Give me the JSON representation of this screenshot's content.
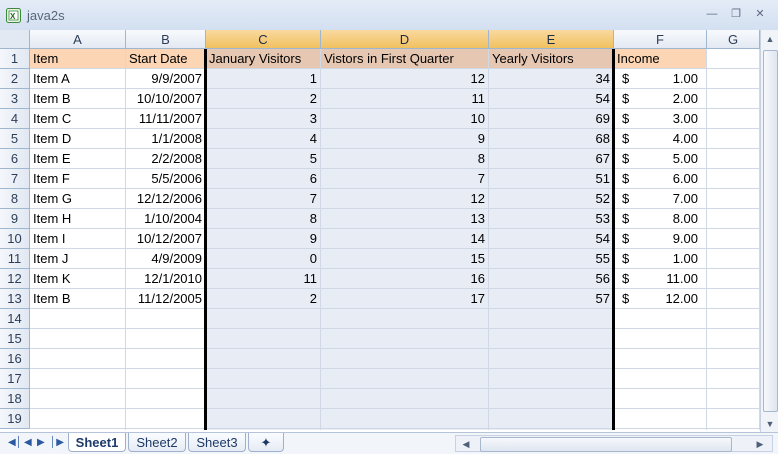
{
  "window": {
    "title": "java2s"
  },
  "columns": [
    "A",
    "B",
    "C",
    "D",
    "E",
    "F",
    "G"
  ],
  "rows": [
    "1",
    "2",
    "3",
    "4",
    "5",
    "6",
    "7",
    "8",
    "9",
    "10",
    "11",
    "12",
    "13",
    "14",
    "15",
    "16",
    "17",
    "18",
    "19"
  ],
  "header_row": [
    "Item",
    "Start Date",
    "January Visitors",
    "Vistors in First Quarter",
    "Yearly Visitors",
    "Income"
  ],
  "data_rows": [
    [
      "Item A",
      "9/9/2007",
      "1",
      "12",
      "34",
      "$",
      "1.00"
    ],
    [
      "Item B",
      "10/10/2007",
      "2",
      "11",
      "54",
      "$",
      "2.00"
    ],
    [
      "Item C",
      "11/11/2007",
      "3",
      "10",
      "69",
      "$",
      "3.00"
    ],
    [
      "Item D",
      "1/1/2008",
      "4",
      "9",
      "68",
      "$",
      "4.00"
    ],
    [
      "Item E",
      "2/2/2008",
      "5",
      "8",
      "67",
      "$",
      "5.00"
    ],
    [
      "Item F",
      "5/5/2006",
      "6",
      "7",
      "51",
      "$",
      "6.00"
    ],
    [
      "Item G",
      "12/12/2006",
      "7",
      "12",
      "52",
      "$",
      "7.00"
    ],
    [
      "Item H",
      "1/10/2004",
      "8",
      "13",
      "53",
      "$",
      "8.00"
    ],
    [
      "Item I",
      "10/12/2007",
      "9",
      "14",
      "54",
      "$",
      "9.00"
    ],
    [
      "Item J",
      "4/9/2009",
      "0",
      "15",
      "55",
      "$",
      "1.00"
    ],
    [
      "Item K",
      "12/1/2010",
      "11",
      "16",
      "56",
      "$",
      "11.00"
    ],
    [
      "Item B",
      "11/12/2005",
      "2",
      "17",
      "57",
      "$",
      "12.00"
    ]
  ],
  "sheets": [
    "Sheet1",
    "Sheet2",
    "Sheet3"
  ],
  "active_sheet": "Sheet1",
  "colors": {
    "header_fill": "#fcd5b4",
    "selection_fill": "#e8ecf5",
    "selected_col_header": "#f1c15f"
  }
}
